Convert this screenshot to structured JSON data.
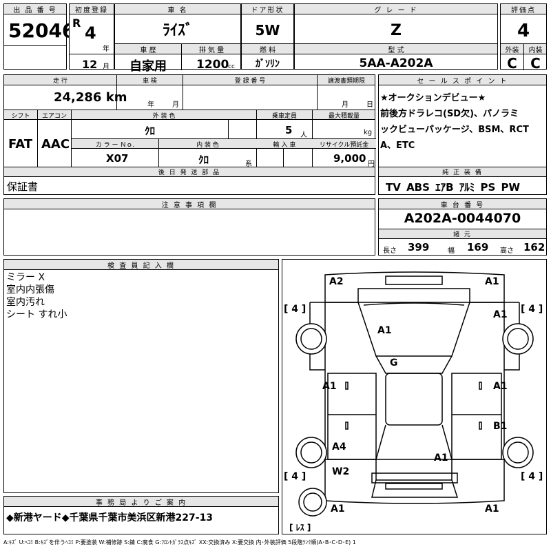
{
  "header": {
    "lot_label": "出 品 番 号",
    "lot_number": "52046",
    "first_reg_label": "初度登録",
    "era": "R",
    "year": "4",
    "year_unit": "年",
    "month": "12",
    "month_unit": "月",
    "car_name_label": "車 名",
    "car_name": "ﾗｲｽﾞ",
    "door_label": "ドア形状",
    "door": "5W",
    "grade_label": "グ レ ー ド",
    "grade": "Z",
    "score_label": "評価点",
    "score": "4",
    "history_label": "車 歴",
    "history": "自家用",
    "displacement_label": "排 気 量",
    "displacement": "1200",
    "displacement_unit": "cc",
    "fuel_label": "燃 料",
    "fuel": "ｶﾞｿﾘﾝ",
    "model_label": "型 式",
    "model": "5AA-A202A",
    "ext_label": "外装",
    "int_label": "内装",
    "ext_grade": "C",
    "int_grade": "C"
  },
  "row2": {
    "mileage_label": "走 行",
    "mileage": "24,286 km",
    "inspection_label": "車 検",
    "inspection_year_unit": "年",
    "inspection_month_unit": "月",
    "reg_no_label": "登 録 番 号",
    "transfer_label": "譲渡書類期限",
    "transfer_month_unit": "月",
    "transfer_day_unit": "日"
  },
  "row3": {
    "shift_label": "シフト",
    "shift": "FAT",
    "ac_label": "エアコン",
    "ac": "AAC",
    "ext_color_label": "外 装 色",
    "ext_color": "ｸﾛ",
    "capacity_label": "乗車定員",
    "capacity": "5",
    "capacity_unit": "人",
    "max_load_label": "最大積載量",
    "max_load_unit": "kg",
    "color_no_label": "カ ラ ー Ｎｏ.",
    "color_no": "X07",
    "int_color_label": "内 装 色",
    "int_color": "ｸﾛ",
    "int_color_unit": "系",
    "import_label": "輸 入 車",
    "recycle_label": "リサイクル預託金",
    "recycle": "9,000",
    "recycle_unit": "円"
  },
  "later_parts": {
    "label": "後 日 発 送 部 品",
    "value": "保証書"
  },
  "notes": {
    "label": "注 意 事 項 欄"
  },
  "inspector": {
    "label": "検 査 員 記 入 欄",
    "lines": [
      "ミラー X",
      "室内内張傷",
      "室内汚れ",
      "シート すれ小"
    ]
  },
  "office": {
    "label": "事 務 局 よ り ご 案 内",
    "value": "◆新港ヤード◆千葉県千葉市美浜区新港227-13"
  },
  "sales_point": {
    "label": "セ ー ル ス ポ イ ン ト",
    "lines": [
      "★オークションデビュー★",
      "前後方ドラレコ(SD欠)、パノラミ",
      "ックビューパッケージ、BSM、RCT",
      "A、ETC"
    ]
  },
  "equipment": {
    "label": "純 正 装 備",
    "value": "TV ABS ｴｱB ｱﾙﾐ PS PW"
  },
  "chassis": {
    "label": "車 台 番 号",
    "value": "A202A-0044070"
  },
  "dimensions": {
    "label": "諸 元",
    "length_label": "長さ",
    "length": "399",
    "width_label": "幅",
    "width": "169",
    "height_label": "高さ",
    "height": "162"
  },
  "diagram": {
    "marks": {
      "front_left": "A2",
      "front_right": "A1",
      "fender_right": "A1",
      "hood": "A1",
      "roof": "G",
      "door_left": "A1",
      "door_right": "A1",
      "rear_door_right": "B1",
      "rear_left": "A4",
      "rear_left2": "W2",
      "trunk": "A1",
      "bumper_left": "A1",
      "bumper_right": "A1"
    },
    "tires": {
      "fl": "[ 4 ]",
      "fr": "[ 4 ]",
      "rl": "[ 4 ]",
      "rr": "[ 4 ]",
      "spare": "[ ﾚｽ ]"
    }
  },
  "legend": "A:ｷｽﾞ U:ﾍｺﾐ B:ｷｽﾞを伴うﾍｺﾐ P:要塗装 W:補修跡 S:錆 C:腐食 G:ﾌﾛﾝﾄｶﾞﾗｽ点ｷｽﾞ XX:交換済み X:要交換 内･外装評価 5段階ﾗﾝｸ順(A･B･C･D･E) 1"
}
